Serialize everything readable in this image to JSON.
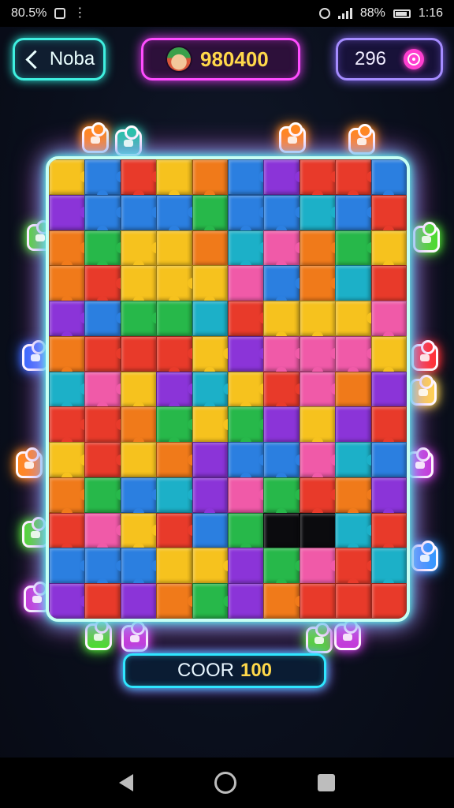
{
  "status_bar": {
    "left_text": "80.5%",
    "time": "1:16",
    "battery": "88%"
  },
  "header": {
    "back_label": "Noba",
    "score": "980400",
    "moves": "296",
    "back_icon": "chevron-left-icon",
    "moves_icon": "target-icon"
  },
  "footer": {
    "label": "COOR",
    "value": "100"
  },
  "board": {
    "columns": 10,
    "rows": 13,
    "missing_tiles": 2,
    "palette": [
      "#e83a2a",
      "#2b7fe0",
      "#27b84a",
      "#f6c21e",
      "#8b34d8",
      "#f07a1a",
      "#1cb0c8",
      "#f05aa8"
    ]
  },
  "colors": {
    "cyan_neon": "#3ff0e0",
    "magenta_neon": "#ff4dff",
    "violet_neon": "#a58cff",
    "gold_text": "#ffd84a"
  }
}
